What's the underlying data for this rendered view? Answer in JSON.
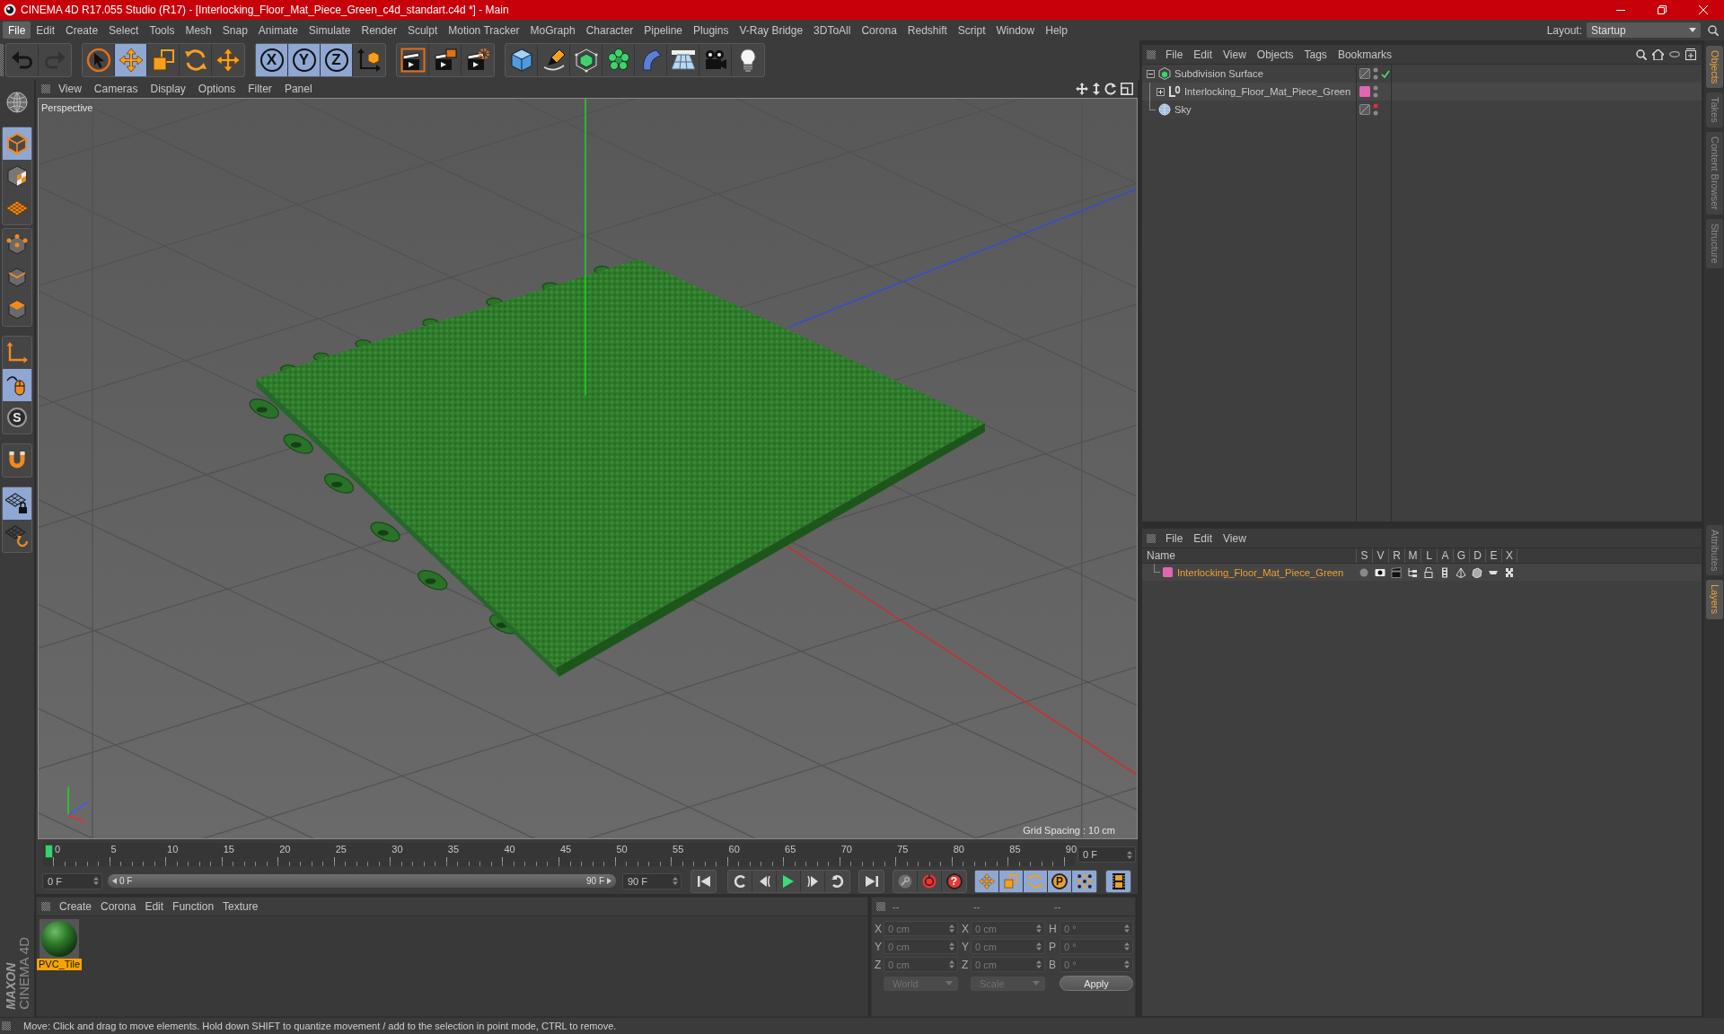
{
  "window": {
    "title": "CINEMA 4D R17.055 Studio (R17) - [Interlocking_Floor_Mat_Piece_Green_c4d_standart.c4d *] - Main"
  },
  "menu_bar": {
    "items": [
      {
        "label": "File",
        "selected": true
      },
      {
        "label": "Edit",
        "selected": false
      },
      {
        "label": "Create",
        "selected": false
      },
      {
        "label": "Select",
        "selected": false
      },
      {
        "label": "Tools",
        "selected": false
      },
      {
        "label": "Mesh",
        "selected": false
      },
      {
        "label": "Snap",
        "selected": false
      },
      {
        "label": "Animate",
        "selected": false
      },
      {
        "label": "Simulate",
        "selected": false
      },
      {
        "label": "Render",
        "selected": false
      },
      {
        "label": "Sculpt",
        "selected": false
      },
      {
        "label": "Motion Tracker",
        "selected": false
      },
      {
        "label": "MoGraph",
        "selected": false
      },
      {
        "label": "Character",
        "selected": false
      },
      {
        "label": "Pipeline",
        "selected": false
      },
      {
        "label": "Plugins",
        "selected": false
      },
      {
        "label": "V-Ray Bridge",
        "selected": false
      },
      {
        "label": "3DToAll",
        "selected": false
      },
      {
        "label": "Corona",
        "selected": false
      },
      {
        "label": "Redshift",
        "selected": false
      },
      {
        "label": "Script",
        "selected": false
      },
      {
        "label": "Window",
        "selected": false
      },
      {
        "label": "Help",
        "selected": false
      }
    ],
    "layout_label": "Layout:",
    "layout_value": "Startup"
  },
  "toolbar": {
    "groups": [
      [
        {
          "selected": false,
          "disabled": false
        },
        {
          "selected": false,
          "disabled": true
        }
      ],
      [
        {
          "selected": false,
          "disabled": false
        },
        {
          "selected": true,
          "disabled": false
        },
        {
          "selected": false,
          "disabled": false
        },
        {
          "selected": false,
          "disabled": false
        },
        {
          "selected": false,
          "disabled": false
        }
      ],
      [
        {
          "label": "X",
          "selected": true,
          "disabled": false
        },
        {
          "label": "Y",
          "selected": true,
          "disabled": false
        },
        {
          "label": "Z",
          "selected": true,
          "disabled": false
        },
        {
          "selected": false,
          "disabled": false
        }
      ],
      [
        {
          "selected": false,
          "disabled": false
        },
        {
          "selected": false,
          "disabled": false
        },
        {
          "selected": false,
          "disabled": false
        }
      ],
      [
        {
          "selected": false,
          "disabled": false
        },
        {
          "selected": false,
          "disabled": false
        },
        {
          "selected": false,
          "disabled": false
        },
        {
          "selected": false,
          "disabled": false
        },
        {
          "selected": false,
          "disabled": false
        },
        {
          "selected": false,
          "disabled": false
        },
        {
          "selected": false,
          "disabled": false
        },
        {
          "selected": false,
          "disabled": false
        }
      ]
    ]
  },
  "left_tools": {
    "groups": [
      [
        {
          "selected": false
        }
      ],
      [
        {
          "selected": true
        },
        {
          "selected": false
        },
        {
          "selected": false
        }
      ],
      [
        {
          "selected": false
        },
        {
          "selected": false
        },
        {
          "selected": false
        }
      ],
      [
        {
          "selected": false
        },
        {
          "selected": true
        },
        {
          "label": "S",
          "selected": false
        }
      ],
      [
        {
          "selected": false
        }
      ],
      [
        {
          "selected": true
        },
        {
          "selected": false
        }
      ]
    ],
    "logo": {
      "brand": "MAXON",
      "product": "CINEMA 4D"
    }
  },
  "viewport": {
    "menu": [
      "View",
      "Cameras",
      "Display",
      "Options",
      "Filter",
      "Panel"
    ],
    "camera": "Perspective",
    "grid_spacing": "Grid Spacing : 10 cm"
  },
  "timeline": {
    "ticks": [
      "0",
      "5",
      "10",
      "15",
      "20",
      "25",
      "30",
      "35",
      "40",
      "45",
      "50",
      "55",
      "60",
      "65",
      "70",
      "75",
      "80",
      "85",
      "90"
    ],
    "level": 0,
    "current_frame": "0 F"
  },
  "transport": {
    "start_frame": "0 F",
    "range": {
      "start": "0 F",
      "end": "90 F",
      "level": 1
    },
    "end_frame": "90 F",
    "key_selection": "?",
    "key_modes": [
      {
        "selected": true
      },
      {
        "selected": true
      },
      {
        "selected": true
      },
      {
        "label": "P",
        "selected": true
      },
      {
        "selected": true
      }
    ],
    "timeline_view": {
      "selected": true
    }
  },
  "materials": {
    "menu": [
      "Create",
      "Corona",
      "Edit",
      "Function",
      "Texture"
    ],
    "items": [
      {
        "name": "PVC_Tile",
        "selected": true
      }
    ]
  },
  "coordinates": {
    "disabled": true,
    "columns": [
      {
        "header": "--",
        "fields": [
          {
            "label": "X",
            "value": "0 cm"
          },
          {
            "label": "Y",
            "value": "0 cm"
          },
          {
            "label": "Z",
            "value": "0 cm"
          }
        ]
      },
      {
        "header": "--",
        "fields": [
          {
            "label": "X",
            "value": "0 cm"
          },
          {
            "label": "Y",
            "value": "0 cm"
          },
          {
            "label": "Z",
            "value": "0 cm"
          }
        ]
      },
      {
        "header": "--",
        "fields": [
          {
            "label": "H",
            "value": "0 °"
          },
          {
            "label": "P",
            "value": "0 °"
          },
          {
            "label": "B",
            "value": "0 °"
          }
        ]
      }
    ],
    "dropdowns": [
      "World",
      "Scale"
    ],
    "button": "Apply"
  },
  "objects": {
    "menu": [
      "File",
      "Edit",
      "View",
      "Objects",
      "Tags",
      "Bookmarks"
    ],
    "tree": [
      {
        "name": "Subdivision Surface",
        "kind": "subdivision",
        "selected": false,
        "expanded": true,
        "editor_off": false,
        "render_off": false,
        "enabled": true,
        "children": [
          {
            "name": "Interlocking_Floor_Mat_Piece_Green",
            "kind": "object",
            "selected": false,
            "expanded": false,
            "color": "#e066b3",
            "editor_off": false,
            "render_off": false,
            "enabled": false
          }
        ]
      },
      {
        "name": "Sky",
        "kind": "sky",
        "selected": false,
        "editor_off": true,
        "render_off": false,
        "enabled": false
      }
    ]
  },
  "layers": {
    "menu": [
      "File",
      "Edit",
      "View"
    ],
    "columns": [
      "Name",
      "S",
      "V",
      "R",
      "M",
      "L",
      "A",
      "G",
      "D",
      "E",
      "X"
    ],
    "rows": [
      {
        "name": "Interlocking_Floor_Mat_Piece_Green",
        "color": "#e066b3",
        "selected": true
      }
    ]
  },
  "side_tabs": {
    "top": [
      {
        "label": "Objects",
        "selected": true
      },
      {
        "label": "Takes",
        "selected": false
      },
      {
        "label": "Content Browser",
        "selected": false
      },
      {
        "label": "Structure",
        "selected": false
      }
    ],
    "bottom": [
      {
        "label": "Attributes",
        "selected": false
      },
      {
        "label": "Layers",
        "selected": true
      }
    ]
  },
  "status_bar": {
    "text": "Move: Click and drag to move elements. Hold down SHIFT to quantize movement / add to the selection in point mode, CTRL to remove."
  }
}
